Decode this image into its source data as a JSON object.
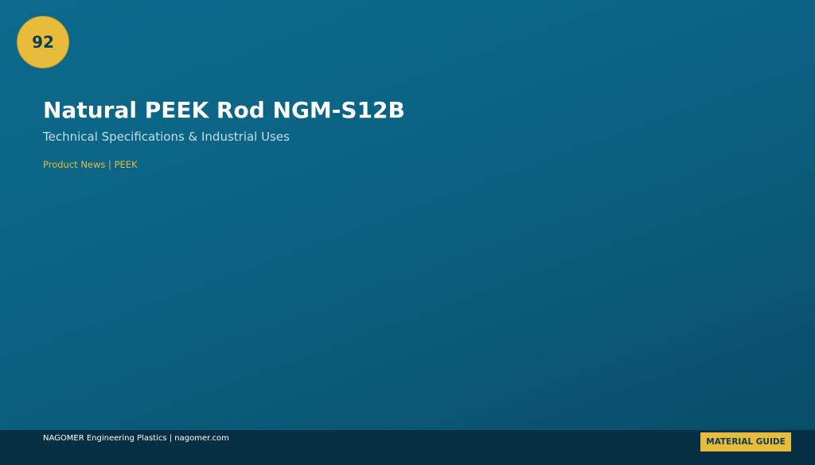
{
  "slide": {
    "number": "92",
    "title": "Natural PEEK Rod NGM-S12B",
    "subtitle": "Technical Specifications & Industrial Uses",
    "tagline": "Product News | PEEK"
  },
  "footer": {
    "company_text": "NAGOMER Engineering Plastics | nagomer.com",
    "button_label": "MATERIAL GUIDE"
  },
  "colors": {
    "background": "#0b6282",
    "accent": "#e7bb3c",
    "footer": "#072f44"
  }
}
